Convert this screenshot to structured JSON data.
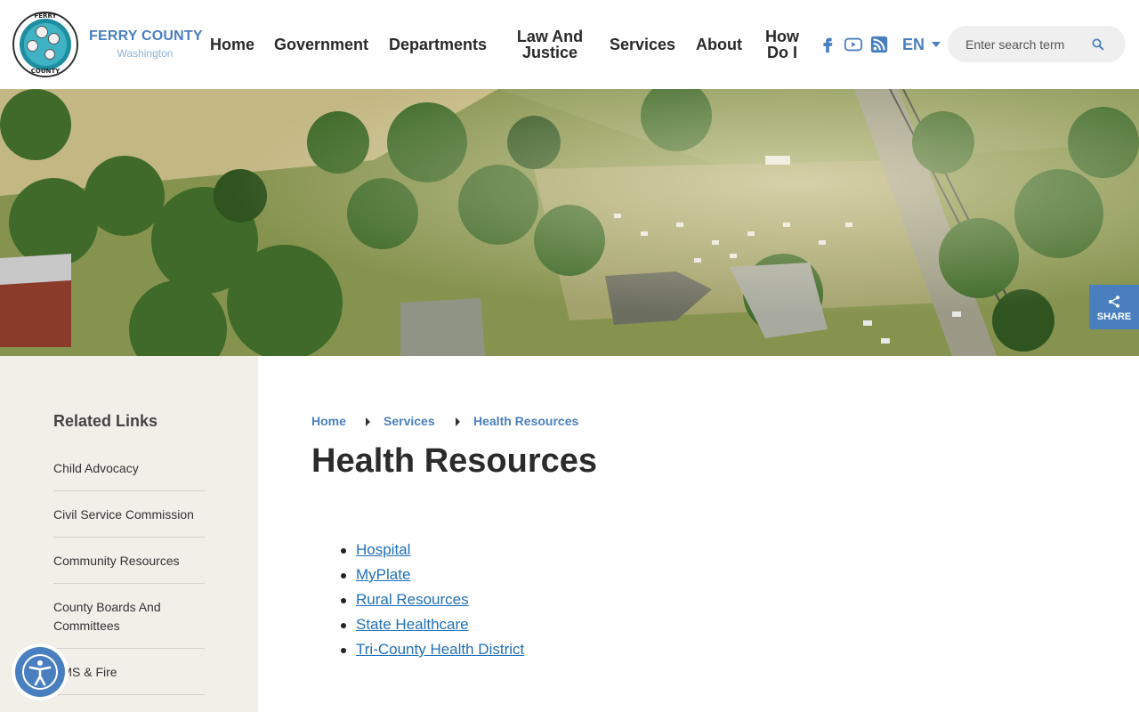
{
  "brand": {
    "logo_top_text": "FERRY",
    "logo_bottom_text": "COUNTY",
    "name": "FERRY COUNTY",
    "state": "Washington"
  },
  "nav": {
    "home": "Home",
    "government": "Government",
    "departments": "Departments",
    "law_line1": "Law And",
    "law_line2": "Justice",
    "services": "Services",
    "about": "About",
    "howdoi_line1": "How",
    "howdoi_line2": "Do I"
  },
  "social": [
    "facebook-icon",
    "youtube-icon",
    "rss-icon"
  ],
  "language": {
    "code": "EN"
  },
  "search": {
    "placeholder": "Enter search terms"
  },
  "share": {
    "label": "SHARE"
  },
  "sidebar": {
    "heading": "Related Links",
    "items": [
      {
        "label": "Child Advocacy"
      },
      {
        "label": "Civil Service Commission"
      },
      {
        "label": "Community Resources"
      },
      {
        "label": "County Boards And Committees"
      },
      {
        "label": "EMS & Fire"
      }
    ]
  },
  "breadcrumb": {
    "items": [
      {
        "label": "Home"
      },
      {
        "label": "Services"
      },
      {
        "label": "Health Resources"
      }
    ]
  },
  "page": {
    "title": "Health Resources"
  },
  "resources": {
    "items": [
      {
        "label": "Hospital"
      },
      {
        "label": "MyPlate"
      },
      {
        "label": "Rural Resources"
      },
      {
        "label": "State Healthcare"
      },
      {
        "label": "Tri-County Health District"
      }
    ]
  },
  "colors": {
    "accent": "#4a7fbf",
    "link": "#1f6fb8",
    "sidebar_bg": "#f2efe9"
  }
}
